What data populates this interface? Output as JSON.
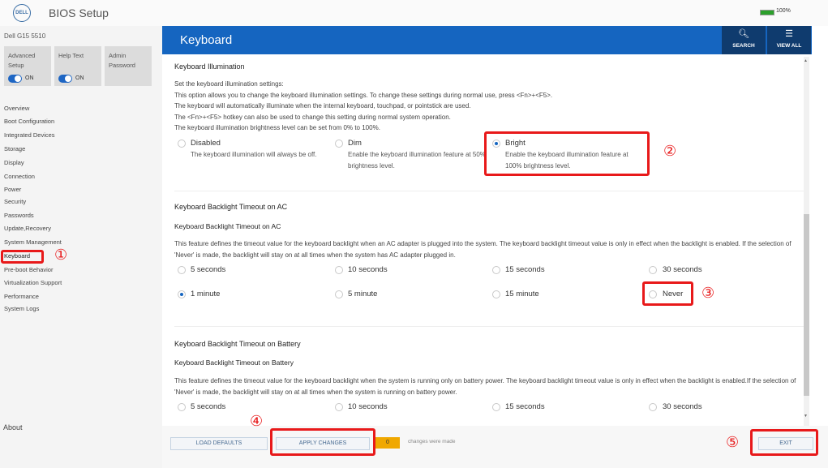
{
  "app": {
    "logo": "DELL",
    "title": "BIOS Setup",
    "battery": "100%"
  },
  "sidebar": {
    "model": "Dell G15 5510",
    "cards": [
      {
        "label": "Advanced Setup",
        "state": "ON"
      },
      {
        "label": "Help Text",
        "state": "ON"
      },
      {
        "label": "Admin Password"
      }
    ],
    "items": [
      "Overview",
      "Boot Configuration",
      "Integrated Devices",
      "Storage",
      "Display",
      "Connection",
      "Power",
      "Security",
      "Passwords",
      "Update,Recovery",
      "System Management",
      "Keyboard",
      "Pre-boot Behavior",
      "Virtualization Support",
      "Performance",
      "System Logs"
    ],
    "about": "About"
  },
  "header": {
    "title": "Keyboard",
    "search": "SEARCH",
    "view_all": "VIEW ALL"
  },
  "illumination": {
    "title": "Keyboard Illumination",
    "desc": [
      "Set the keyboard illumination settings:",
      "This option allows you to change the keyboard illumination settings. To change these settings during normal use, press <Fn>+<F5>.",
      "The keyboard will automatically illuminate when the internal keyboard, touchpad, or pointstick are used.",
      "The <Fn>+<F5> hotkey can also be used to change this setting during normal system operation.",
      "The keyboard illumination brightness level can be set from 0% to 100%."
    ],
    "options": [
      {
        "label": "Disabled",
        "desc": "The keyboard illumination will always be off.",
        "selected": false
      },
      {
        "label": "Dim",
        "desc": "Enable the keyboard illumination feature at 50% brightness level.",
        "selected": false
      },
      {
        "label": "Bright",
        "desc": "Enable the keyboard illumination feature at 100% brightness level.",
        "selected": true
      }
    ]
  },
  "ac": {
    "title": "Keyboard Backlight Timeout on AC",
    "subtitle": "Keyboard Backlight Timeout on AC",
    "desc": "This feature defines the timeout value for the keyboard backlight when an AC adapter is plugged into the system. The keyboard backlight timeout value is only in effect when the backlight is enabled. If the selection of 'Never' is made, the backlight will stay on at all times when the system has AC adapter plugged in.",
    "options": [
      "5 seconds",
      "10 seconds",
      "15 seconds",
      "30 seconds",
      "1 minute",
      "5 minute",
      "15 minute",
      "Never"
    ],
    "selected": "1 minute"
  },
  "battery": {
    "title": "Keyboard Backlight Timeout on Battery",
    "subtitle": "Keyboard Backlight Timeout on Battery",
    "desc": "This feature defines the timeout value for the keyboard backlight when the system is running only on battery power. The keyboard backlight timeout value is only in effect when the backlight is enabled.If the selection of 'Never' is made, the backlight will stay on at all times when the system is running on battery power.",
    "options": [
      "5 seconds",
      "10 seconds",
      "15 seconds",
      "30 seconds"
    ]
  },
  "footer": {
    "load_defaults": "LOAD DEFAULTS",
    "apply_changes": "APPLY CHANGES",
    "change_count": "0",
    "changes_text": "changes were made",
    "exit": "EXIT"
  },
  "annotations": {
    "m1": "①",
    "m2": "②",
    "m3": "③",
    "m4": "④",
    "m5": "⑤"
  },
  "colors": {
    "header_blue": "#1565c0",
    "header_dark": "#0f3b6e",
    "highlight_red": "#e8191a",
    "counter_orange": "#f0a800"
  }
}
